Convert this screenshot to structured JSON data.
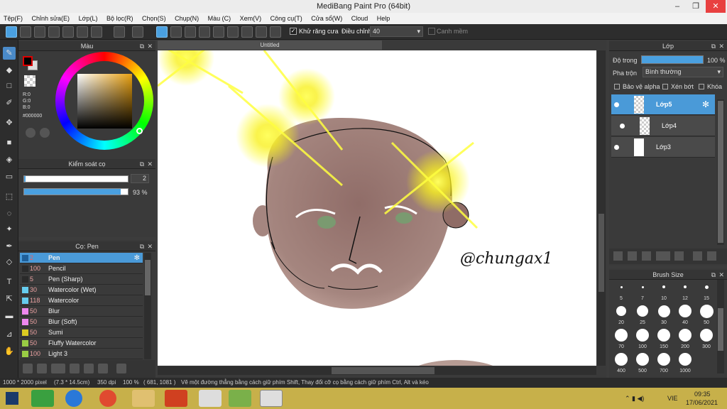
{
  "window": {
    "title": "MediBang Paint Pro (64bit)"
  },
  "menu": [
    "Tệp(F)",
    "Chỉnh sửa(E)",
    "Lớp(L)",
    "Bộ lọc(R)",
    "Chọn(S)",
    "Chụp(N)",
    "Màu (C)",
    "Xem(V)",
    "Công cụ(T)",
    "Cửa sổ(W)",
    "Cloud",
    "Help"
  ],
  "toolbar": {
    "antialias": "Khử răng cưa",
    "adjust_label": "Điều chỉnh",
    "adjust_value": "40",
    "smooth": "Canh mềm"
  },
  "color_panel": {
    "title": "Màu",
    "r": "R:0",
    "g": "G:0",
    "b": "B:0",
    "hex": "#000000"
  },
  "brush_control": {
    "title": "Kiểm soát cọ",
    "size": "2",
    "opacity": "93 %"
  },
  "brush_panel": {
    "title": "Cọ: Pen",
    "items": [
      {
        "size": "2",
        "name": "Pen",
        "color": "#1e5f99"
      },
      {
        "size": "100",
        "name": "Pencil",
        "color": "#2a2a2a"
      },
      {
        "size": "5",
        "name": "Pen (Sharp)",
        "color": "#2a2a2a"
      },
      {
        "size": "30",
        "name": "Watercolor (Wet)",
        "color": "#66ccee"
      },
      {
        "size": "118",
        "name": "Watercolor",
        "color": "#66ccee"
      },
      {
        "size": "50",
        "name": "Blur",
        "color": "#ee88ee"
      },
      {
        "size": "50",
        "name": "Blur (Soft)",
        "color": "#ee88ee"
      },
      {
        "size": "50",
        "name": "Sumi",
        "color": "#ddcc22"
      },
      {
        "size": "50",
        "name": "Fluffy Watercolor",
        "color": "#99cc44"
      },
      {
        "size": "100",
        "name": "Light 3",
        "color": "#99cc44"
      }
    ]
  },
  "canvas": {
    "tab": "Untitled",
    "signature": "@chungax1"
  },
  "layer_panel": {
    "title": "Lớp",
    "opacity_label": "Độ trong",
    "opacity_value": "100 %",
    "blend_label": "Pha trộn",
    "blend_value": "Bình thường",
    "protect_alpha": "Bảo vệ alpha",
    "clipping": "Xén bớt",
    "lock": "Khóa",
    "layers": [
      "Lớp5",
      "Lớp4",
      "Lớp3"
    ]
  },
  "brush_size": {
    "title": "Brush Size",
    "sizes": [
      "5",
      "7",
      "10",
      "12",
      "15",
      "20",
      "25",
      "30",
      "40",
      "50",
      "70",
      "100",
      "150",
      "200",
      "300",
      "400",
      "500",
      "700",
      "1000"
    ]
  },
  "status": {
    "dims": "1000 * 2000 pixel",
    "cm": "(7.3 * 14.5cm)",
    "dpi": "350 dpi",
    "zoom": "100 %",
    "coords": "( 681, 1081 )",
    "hint": "Vẽ một đường thẳng bằng cách giữ phím Shift, Thay đổi cỡ cọ bằng cách giữ phím Ctrl, Alt và kéo"
  },
  "taskbar": {
    "lang": "VIE",
    "time": "09:35",
    "date": "17/06/2021"
  },
  "colors": {
    "accent": "#4aa0e0",
    "panel": "#3a3a3a",
    "taskbar": "#c7b04a"
  }
}
